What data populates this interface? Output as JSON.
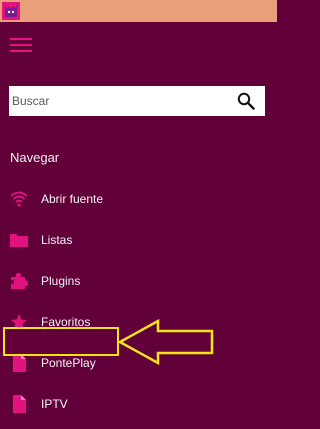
{
  "window": {
    "icon": "app-logo-icon"
  },
  "header": {
    "menu_icon": "hamburger-menu-icon"
  },
  "search": {
    "placeholder": "Buscar",
    "value": "",
    "icon": "search-icon"
  },
  "nav": {
    "section_title": "Navegar",
    "items": [
      {
        "label": "Abrir fuente",
        "icon": "wifi-icon"
      },
      {
        "label": "Listas",
        "icon": "folder-icon"
      },
      {
        "label": "Plugins",
        "icon": "puzzle-icon"
      },
      {
        "label": "Favoritos",
        "icon": "star-icon"
      },
      {
        "label": "PontePlay",
        "icon": "document-icon",
        "selected": true
      },
      {
        "label": "IPTV",
        "icon": "document-icon"
      }
    ]
  },
  "annotation": {
    "highlight": "PontePlay"
  },
  "colors": {
    "background": "#62003a",
    "accent": "#e2127f",
    "titlebar": "#e9a07a",
    "annotation": "#f5e31a"
  }
}
